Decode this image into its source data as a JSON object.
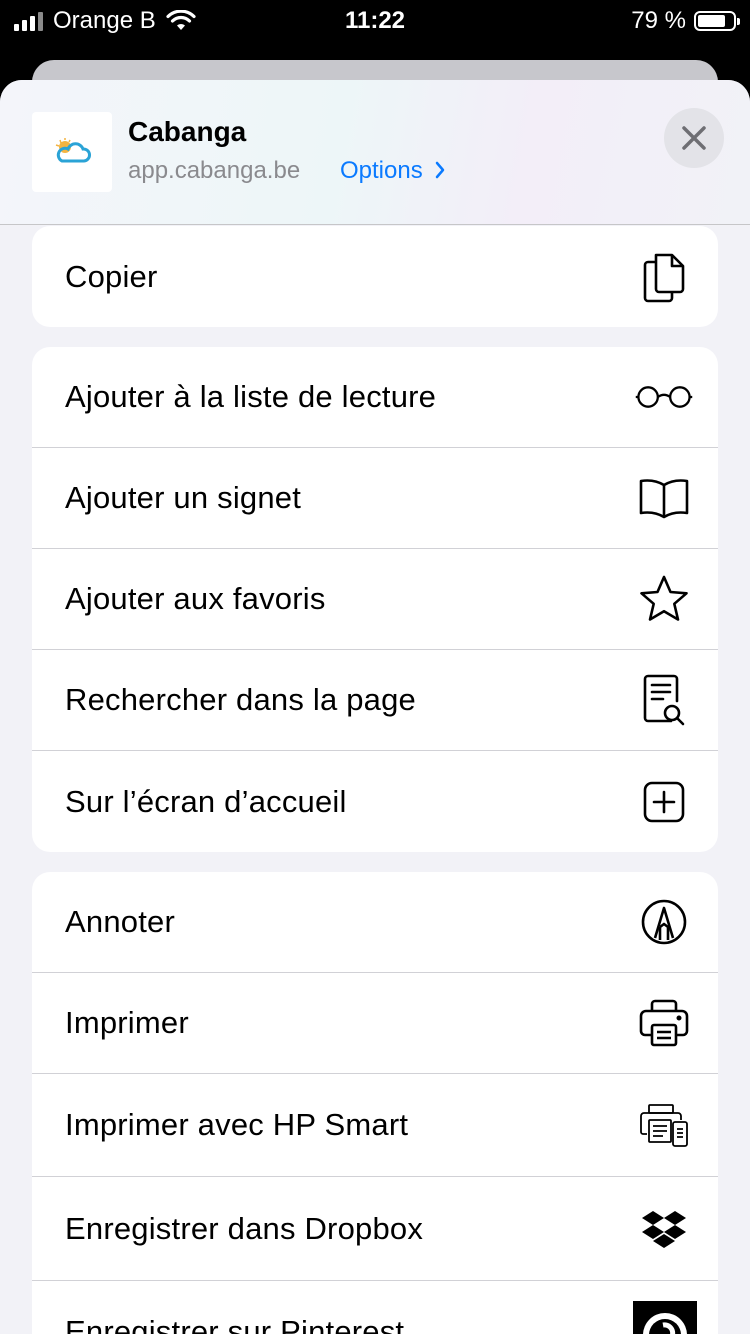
{
  "status_bar": {
    "carrier": "Orange B",
    "time": "11:22",
    "battery_percent": "79 %",
    "battery_level": 0.79
  },
  "share_sheet": {
    "app_name": "Cabanga",
    "app_url": "app.cabanga.be",
    "options_label": "Options",
    "accent_color": "#0a7aff",
    "groups": [
      [
        {
          "label": "Copier",
          "icon": "copy-icon"
        }
      ],
      [
        {
          "label": "Ajouter à la liste de lecture",
          "icon": "glasses-icon"
        },
        {
          "label": "Ajouter un signet",
          "icon": "book-icon"
        },
        {
          "label": "Ajouter aux favoris",
          "icon": "star-icon"
        },
        {
          "label": "Rechercher dans la page",
          "icon": "find-in-page-icon"
        },
        {
          "label": "Sur l’écran d’accueil",
          "icon": "add-square-icon"
        }
      ],
      [
        {
          "label": "Annoter",
          "icon": "markup-icon"
        },
        {
          "label": "Imprimer",
          "icon": "printer-icon"
        },
        {
          "label": "Imprimer avec HP Smart",
          "icon": "hp-smart-icon"
        },
        {
          "label": "Enregistrer dans Dropbox",
          "icon": "dropbox-icon"
        },
        {
          "label": "Enregistrer sur Pinterest",
          "icon": "pinterest-icon"
        }
      ]
    ]
  }
}
